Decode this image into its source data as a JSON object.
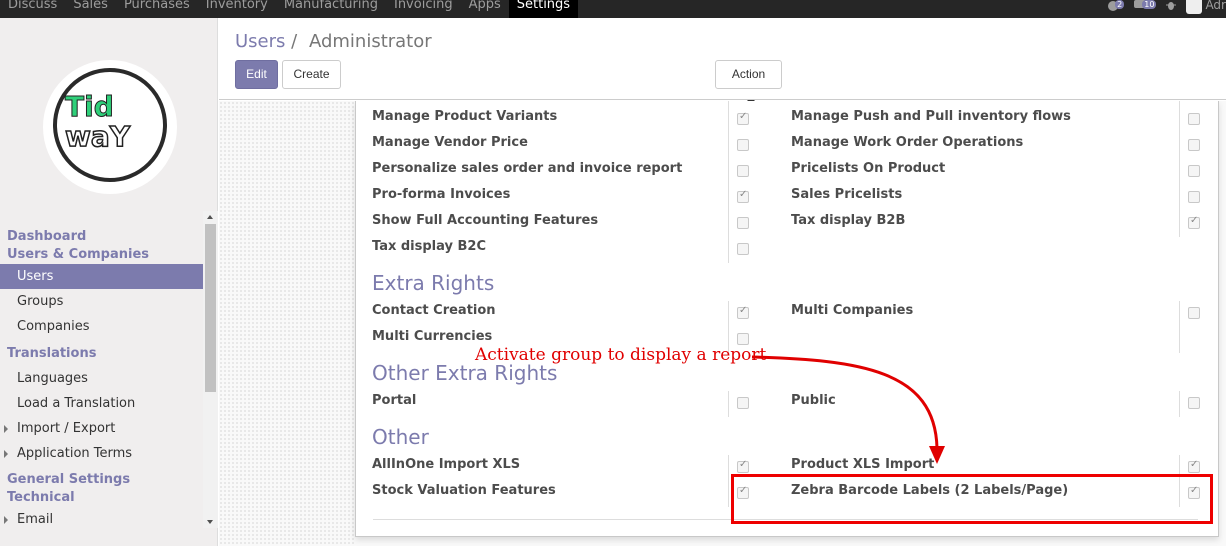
{
  "topbar": {
    "menu": [
      "Discuss",
      "Sales",
      "Purchases",
      "Inventory",
      "Manufacturing",
      "Invoicing",
      "Apps",
      "Settings"
    ],
    "active": "Settings",
    "chat_count": "2",
    "activity_count": "10",
    "user": "Adr"
  },
  "sidebar": {
    "logo_top": "Tid",
    "logo_bottom": "waY",
    "sections": {
      "dashboard": "Dashboard",
      "users_companies": "Users & Companies",
      "users": "Users",
      "groups": "Groups",
      "companies": "Companies",
      "translations": "Translations",
      "languages": "Languages",
      "load_translation": "Load a Translation",
      "import_export": "Import / Export",
      "application_terms": "Application Terms",
      "general_settings": "General Settings",
      "technical": "Technical",
      "email": "Email"
    }
  },
  "control_panel": {
    "breadcrumb_parent": "Users",
    "breadcrumb_sep": "/",
    "breadcrumb_current": "Administrator",
    "edit_label": "Edit",
    "create_label": "Create",
    "action_label": "Action"
  },
  "form": {
    "rows_top": [
      {
        "left": "Manage Product Variants",
        "left_checked": true,
        "right": "Manage Push and Pull inventory flows",
        "right_checked": false
      },
      {
        "left": "Manage Vendor Price",
        "left_checked": false,
        "right": "Manage Work Order Operations",
        "right_checked": false
      },
      {
        "left": "Personalize sales order and invoice report",
        "left_checked": false,
        "right": "Pricelists On Product",
        "right_checked": false
      },
      {
        "left": "Pro-forma Invoices",
        "left_checked": true,
        "right": "Sales Pricelists",
        "right_checked": false
      },
      {
        "left": "Show Full Accounting Features",
        "left_checked": false,
        "right": "Tax display B2B",
        "right_checked": true
      },
      {
        "left": "Tax display B2C",
        "left_checked": false
      }
    ],
    "extra_rights_title": "Extra Rights",
    "extra_rights": [
      {
        "left": "Contact Creation",
        "left_checked": true,
        "right": "Multi Companies",
        "right_checked": false
      },
      {
        "left": "Multi Currencies",
        "left_checked": false
      }
    ],
    "other_extra_rights_title": "Other Extra Rights",
    "other_extra_rights": [
      {
        "left": "Portal",
        "left_checked": false,
        "right": "Public",
        "right_checked": false
      }
    ],
    "other_title": "Other",
    "other": [
      {
        "left": "AllInOne Import XLS",
        "left_checked": true,
        "right": "Product XLS Import",
        "right_checked": true
      },
      {
        "left": "Stock Valuation Features",
        "left_checked": true,
        "right": "Zebra Barcode Labels (2 Labels/Page)",
        "right_checked": true
      }
    ]
  },
  "annotation": {
    "text": "Activate group to display a report",
    "color": "#e00000"
  },
  "colors": {
    "accent": "#7c7bad",
    "topbar": "#262626"
  }
}
